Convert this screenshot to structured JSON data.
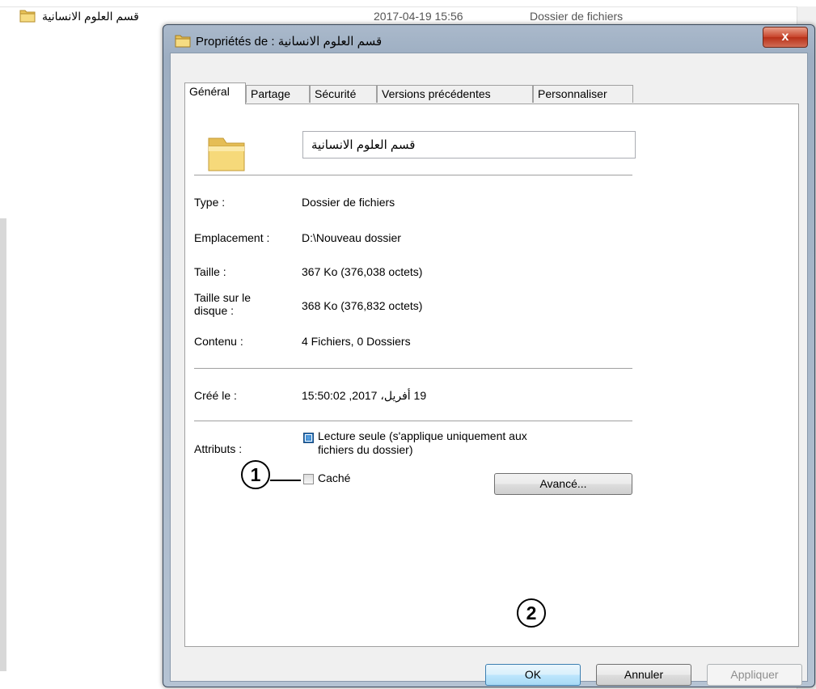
{
  "background": {
    "row_name": "قسم العلوم الانسانية",
    "row_date": "2017-04-19 15:56",
    "row_type": "Dossier de fichiers"
  },
  "window": {
    "title": "Propriétés de : قسم العلوم الانسانية",
    "close_label": "x"
  },
  "tabs": [
    "Général",
    "Partage",
    "Sécurité",
    "Versions précédentes",
    "Personnaliser"
  ],
  "general": {
    "folder_name": "قسم العلوم الانسانية",
    "type_label": "Type :",
    "type_value": "Dossier de fichiers",
    "location_label": "Emplacement :",
    "location_value": "D:\\Nouveau dossier",
    "size_label": "Taille :",
    "size_value": "367 Ko (376,038 octets)",
    "disk_size_label_1": "Taille sur le",
    "disk_size_label_2": "disque :",
    "disk_size_value": "368 Ko (376,832 octets)",
    "contents_label": "Contenu :",
    "contents_value": "4 Fichiers, 0 Dossiers",
    "created_label": "Créé le :",
    "created_value": "19 أفريل، 2017, 15:50:02",
    "attributes_label": "Attributs :",
    "readonly_label_1": "Lecture seule (s'applique uniquement aux",
    "readonly_label_2": "fichiers du dossier)",
    "hidden_label": "Caché",
    "advanced_button": "Avancé..."
  },
  "buttons": {
    "ok": "OK",
    "cancel": "Annuler",
    "apply": "Appliquer"
  },
  "callouts": {
    "one": "1",
    "two": "2"
  },
  "colors": {
    "checkbox_checked": "#1f6ab2",
    "ok_button": "#bee6fd",
    "close_button": "#c7432a"
  }
}
